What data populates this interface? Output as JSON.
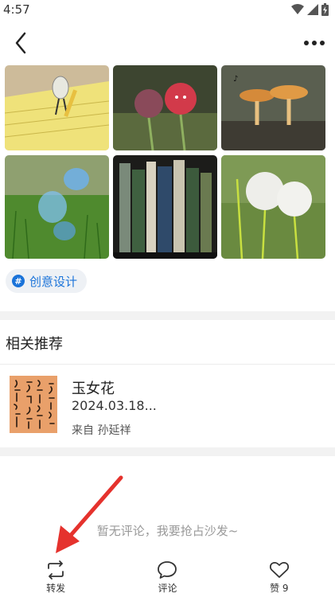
{
  "status_bar": {
    "time": "4:57"
  },
  "photo_grid": {
    "items": [
      "lightbulb-figure-on-notepad",
      "raspberry-figures",
      "mushroom-figures",
      "glass-figures-on-grass",
      "book-spine-figures",
      "dandelion-figures"
    ]
  },
  "tag": {
    "icon": "#",
    "label": "创意设计"
  },
  "related": {
    "title": "相关推荐",
    "items": [
      {
        "title": "玉女花",
        "date": "2024.03.18...",
        "source": "来自 孙延祥"
      }
    ]
  },
  "comments": {
    "empty_text": "暂无评论，我要抢占沙发~"
  },
  "bottom_bar": {
    "share_label": "转发",
    "comment_label": "评论",
    "like_label": "赞 9"
  },
  "colors": {
    "accent": "#1a73d9",
    "annotation_arrow": "#e5322d"
  }
}
